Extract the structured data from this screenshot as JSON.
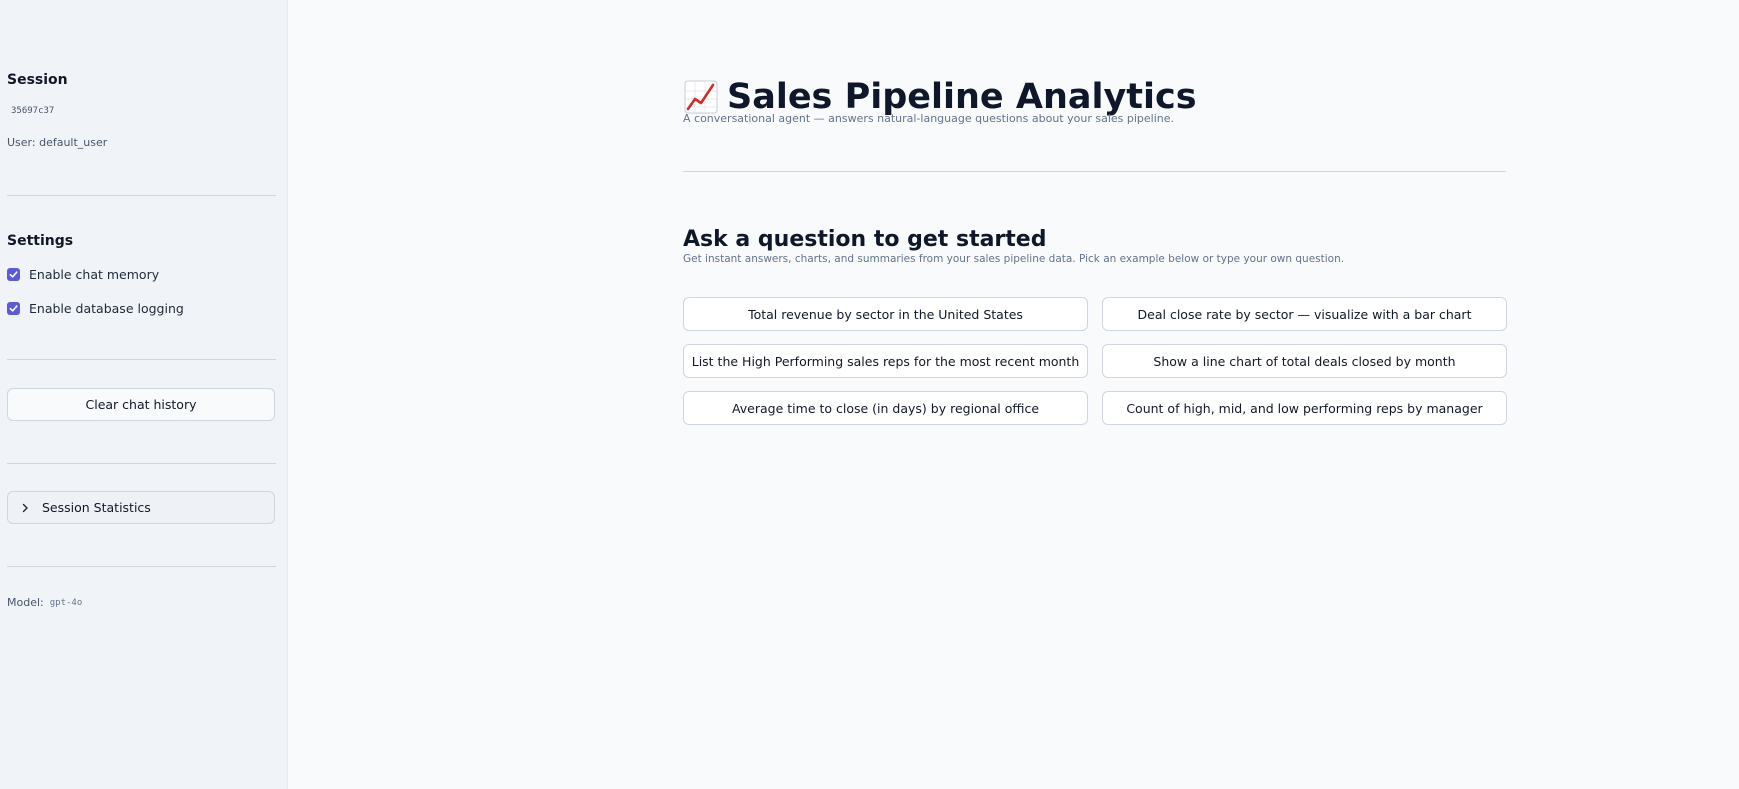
{
  "sidebar": {
    "session_heading": "Session",
    "session_id": "35697c37",
    "user_line": "User: default_user",
    "settings_heading": "Settings",
    "settings": [
      {
        "label": "Enable chat memory",
        "checked": true
      },
      {
        "label": "Enable database logging",
        "checked": true
      }
    ],
    "clear_button_label": "Clear chat history",
    "stats_expander_label": "Session Statistics",
    "model_label": "Model:",
    "model_value": "gpt-4o"
  },
  "main": {
    "title": "Sales Pipeline Analytics",
    "title_icon": "chart-increasing-icon",
    "subtitle": "A conversational agent — answers natural-language questions about your sales pipeline.",
    "section_title": "Ask a question to get started",
    "section_desc": "Get instant answers, charts, and summaries from your sales pipeline data. Pick an example below or type your own question.",
    "examples": [
      "Total revenue by sector in the United States",
      "Deal close rate by sector — visualize with a bar chart",
      "List the High Performing sales reps for the most recent month",
      "Show a line chart of total deals closed by month",
      "Average time to close (in days) by regional office",
      "Count of high, mid, and low performing reps by manager"
    ]
  },
  "colors": {
    "accent": "#5b5bd6",
    "sidebar_bg": "#f0f3f8",
    "main_bg": "#f8fafc"
  }
}
